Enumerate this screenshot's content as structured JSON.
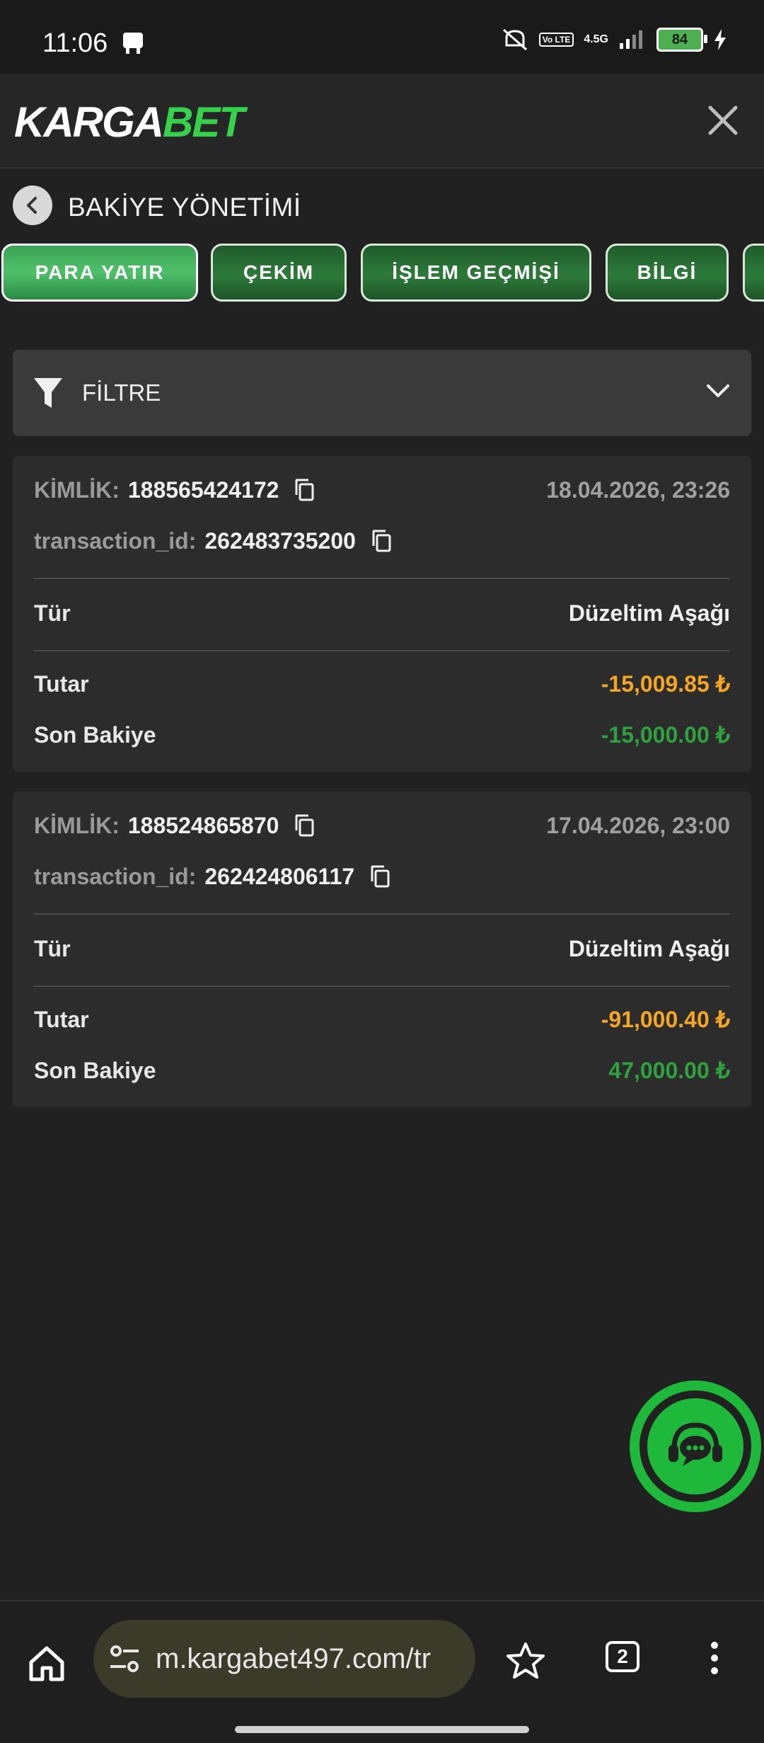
{
  "status": {
    "time": "11:06",
    "battery": "84",
    "network": "4.5G",
    "lte": "Vo LTE"
  },
  "header": {
    "logo_part1": "KARGA",
    "logo_part2": "BET"
  },
  "page": {
    "title": "BAKİYE YÖNETİMİ"
  },
  "tabs": [
    {
      "label": "PARA YATIR",
      "active": true
    },
    {
      "label": "ÇEKİM"
    },
    {
      "label": "İŞLEM GEÇMİŞİ"
    },
    {
      "label": "BİLGİ"
    }
  ],
  "filter": {
    "label": "FİLTRE"
  },
  "transactions": [
    {
      "id_label": "KİMLİK:",
      "id": "188565424172",
      "date": "18.04.2026, 23:26",
      "txn_label": "transaction_id:",
      "txn_id": "262483735200",
      "type_label": "Tür",
      "type": "Düzeltim Aşağı",
      "amount_label": "Tutar",
      "amount": "-15,009.85 ₺",
      "balance_label": "Son Bakiye",
      "balance": "-15,000.00 ₺"
    },
    {
      "id_label": "KİMLİK:",
      "id": "188524865870",
      "date": "17.04.2026, 23:00",
      "txn_label": "transaction_id:",
      "txn_id": "262424806117",
      "type_label": "Tür",
      "type": "Düzeltim Aşağı",
      "amount_label": "Tutar",
      "amount": "-91,000.40 ₺",
      "balance_label": "Son Bakiye",
      "balance": "47,000.00 ₺"
    }
  ],
  "browser": {
    "url": "m.kargabet497.com/tr",
    "tab_count": "2"
  },
  "colors": {
    "accent_green": "#2fa23f",
    "amount_orange": "#f5a623",
    "tab_green": "#2d7a3a"
  }
}
